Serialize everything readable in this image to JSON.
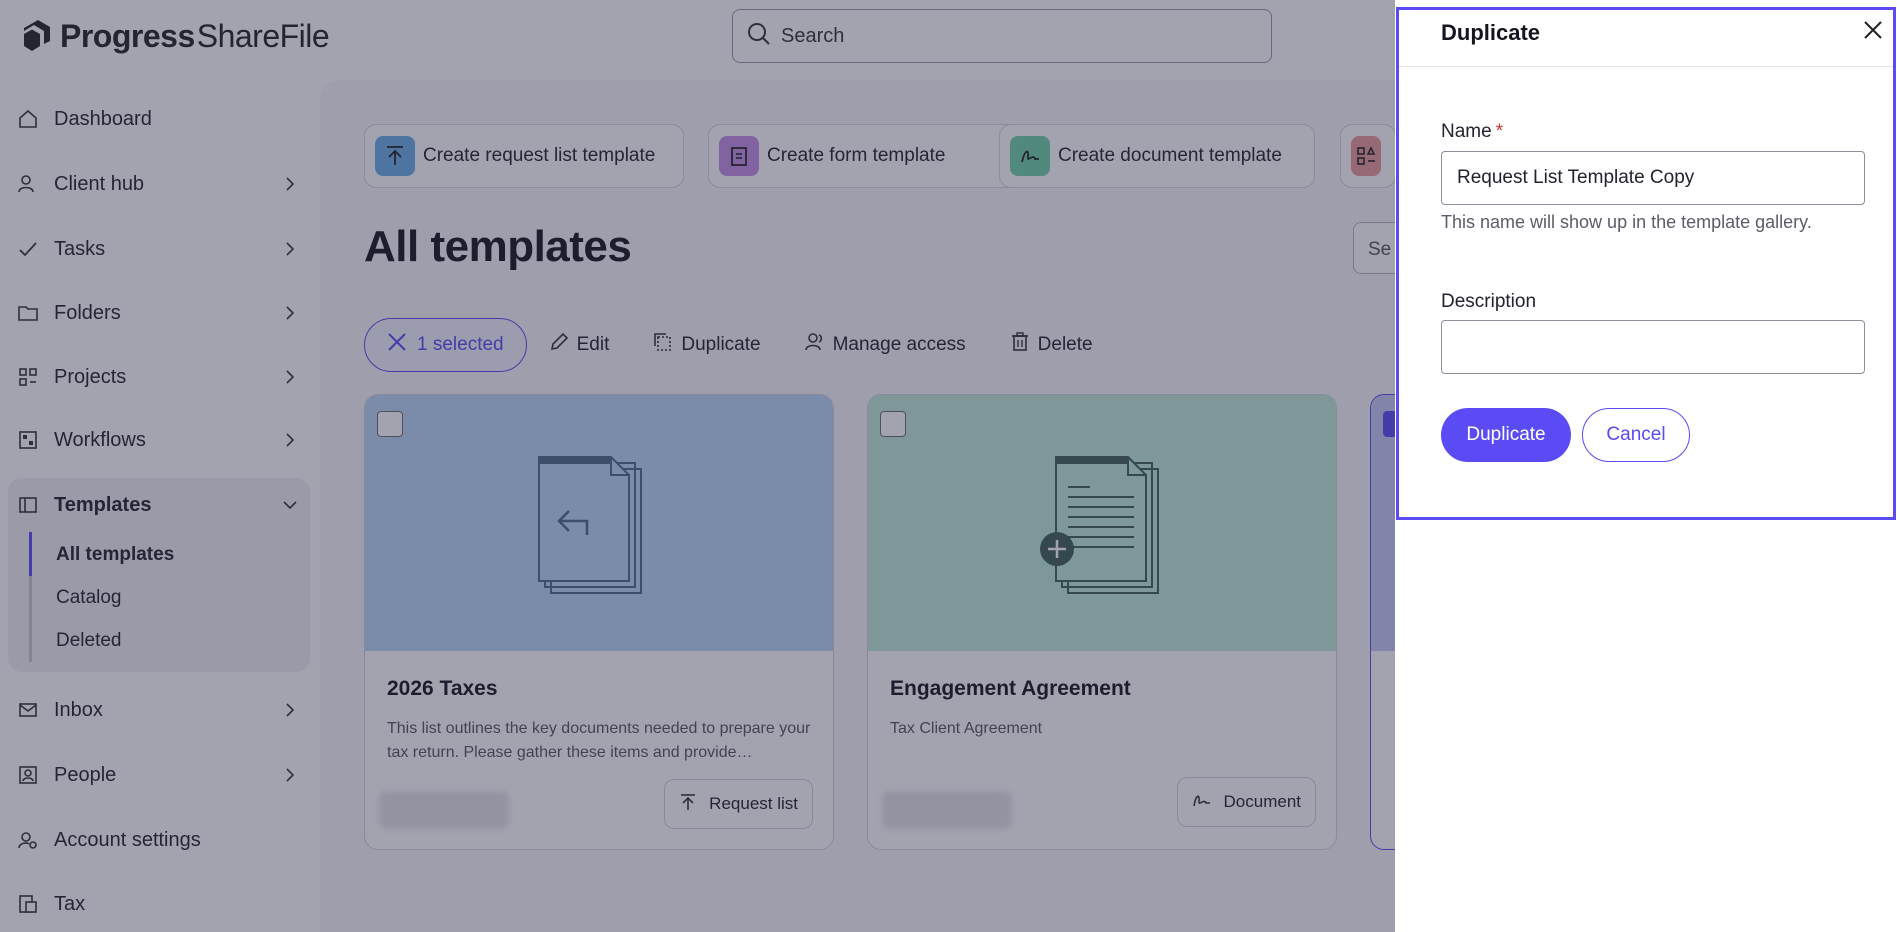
{
  "header": {
    "brand_primary": "Progress",
    "brand_secondary": "ShareFile",
    "search_placeholder": "Search"
  },
  "sidebar": {
    "items": [
      {
        "label": "Dashboard",
        "icon": "home-icon"
      },
      {
        "label": "Client hub",
        "icon": "people-icon"
      },
      {
        "label": "Tasks",
        "icon": "check-icon"
      },
      {
        "label": "Folders",
        "icon": "folder-icon"
      },
      {
        "label": "Projects",
        "icon": "projects-icon"
      },
      {
        "label": "Workflows",
        "icon": "workflow-icon"
      },
      {
        "label": "Templates",
        "icon": "templates-icon"
      },
      {
        "label": "Inbox",
        "icon": "inbox-icon"
      },
      {
        "label": "People",
        "icon": "person-icon"
      },
      {
        "label": "Account settings",
        "icon": "settings-icon"
      },
      {
        "label": "Tax",
        "icon": "tax-icon"
      }
    ],
    "templates_sub": [
      "All templates",
      "Catalog",
      "Deleted"
    ]
  },
  "main": {
    "quick_actions": [
      {
        "label": "Create request list template",
        "color": "#6aaee8"
      },
      {
        "label": "Create form template",
        "color": "#c48fe6"
      },
      {
        "label": "Create document template",
        "color": "#6fd1aa"
      },
      {
        "label": "",
        "color": "#ea9a9a"
      }
    ],
    "title": "All templates",
    "search_partial": "Se",
    "toolbar": {
      "selected": "1 selected",
      "edit": "Edit",
      "duplicate": "Duplicate",
      "manage_access": "Manage access",
      "delete": "Delete"
    },
    "cards": [
      {
        "title": "2026 Taxes",
        "description": "This list outlines the key documents needed to prepare your tax return. Please gather these items and provide…",
        "type": "Request list",
        "hero_color": "#b8d7f7"
      },
      {
        "title": "Engagement Agreement",
        "description": "Tax Client Agreement",
        "type": "Document",
        "hero_color": "#bfead9"
      }
    ]
  },
  "panel": {
    "title": "Duplicate",
    "name_label": "Name",
    "required_mark": "*",
    "name_value": "Request List Template Copy",
    "name_hint": "This name will show up in the template gallery.",
    "description_label": "Description",
    "description_value": "",
    "primary_button": "Duplicate",
    "secondary_button": "Cancel"
  },
  "colors": {
    "accent": "#5b4bf5",
    "required": "#d92d2d"
  }
}
